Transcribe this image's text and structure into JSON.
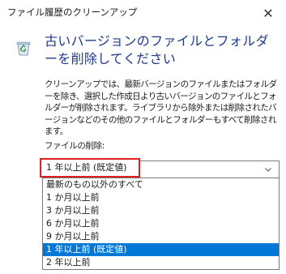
{
  "window": {
    "title": "ファイル履歴のクリーンアップ",
    "close_glyph": "✕"
  },
  "app_icon": "recycle-bin-icon",
  "heading": "古いバージョンのファイルとフォルダーを削除してください",
  "description": "クリーンアップでは、最新バージョンのファイルまたはフォルダーを除き、選択した作成日より古いバージョンのファイルとフォルダーが削除されます。ライブラリから除外または削除されたバージョンなどのその他のファイルとフォルダーもすべて削除されます。",
  "delete_label": "ファイルの削除:",
  "dropdown": {
    "value": "1 年以上前 (既定値)",
    "highlight_color": "#e02020",
    "options": [
      "最新のもの以外のすべて",
      "1 か月以上前",
      "3 か月以上前",
      "6 か月以上前",
      "9 か月以上前",
      "1 年以上前 (既定値)",
      "2 年以上前"
    ],
    "selected_index": 5,
    "selection_color": "#0078d7"
  }
}
